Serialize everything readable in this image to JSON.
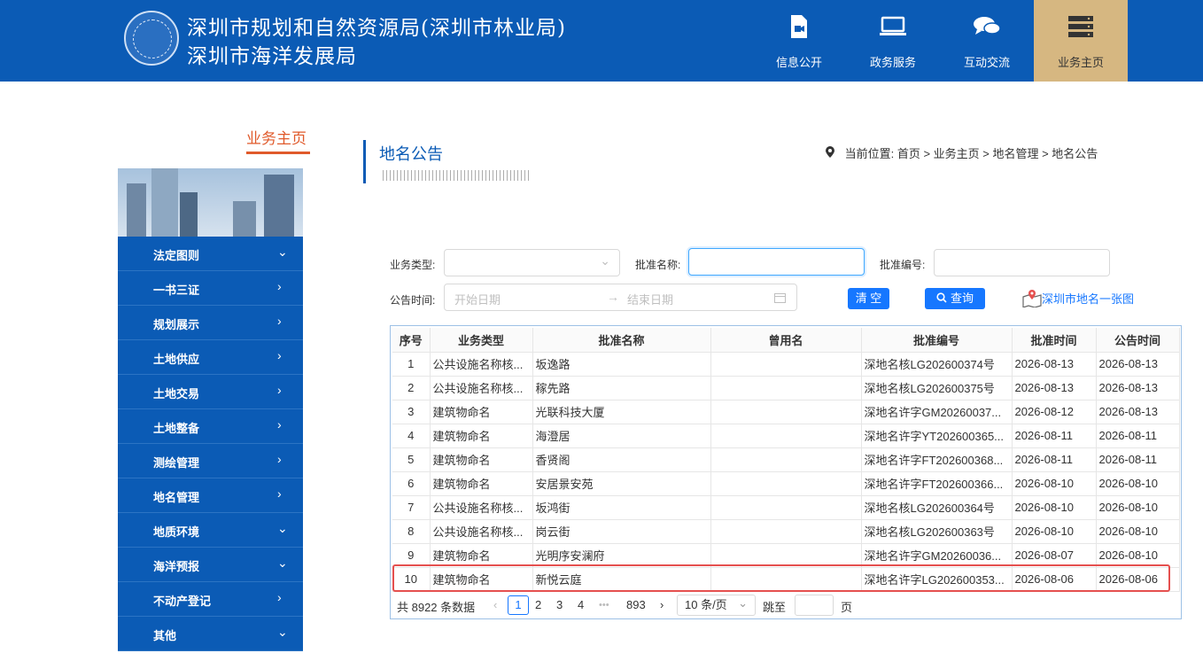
{
  "header": {
    "org_line1": "深圳市规划和自然资源局(深圳市林业局)",
    "org_line2": "深圳市海洋发展局",
    "nav": [
      {
        "label": "信息公开",
        "icon": "document-video-icon"
      },
      {
        "label": "政务服务",
        "icon": "monitor-icon"
      },
      {
        "label": "互动交流",
        "icon": "chat-bubbles-icon"
      },
      {
        "label": "业务主页",
        "icon": "server-icon",
        "active": true
      }
    ],
    "bg_color": "#0b5bb5",
    "active_color": "#d6b781"
  },
  "sidebar": {
    "title": "业务主页",
    "items": [
      {
        "label": "法定图则",
        "chev": "⌄"
      },
      {
        "label": "一书三证",
        "chev": "›"
      },
      {
        "label": "规划展示",
        "chev": "›"
      },
      {
        "label": "土地供应",
        "chev": "›"
      },
      {
        "label": "土地交易",
        "chev": "›"
      },
      {
        "label": "土地整备",
        "chev": "›"
      },
      {
        "label": "测绘管理",
        "chev": "›"
      },
      {
        "label": "地名管理",
        "chev": "›"
      },
      {
        "label": "地质环境",
        "chev": "⌄"
      },
      {
        "label": "海洋预报",
        "chev": "⌄"
      },
      {
        "label": "不动产登记",
        "chev": "›"
      },
      {
        "label": "其他",
        "chev": "⌄"
      }
    ]
  },
  "page": {
    "title": "地名公告",
    "breadcrumb": "当前位置:  首页 > 业务主页 > 地名管理 > 地名公告"
  },
  "filters": {
    "type_label": "业务类型:",
    "name_label": "批准名称:",
    "code_label": "批准编号:",
    "date_label": "公告时间:",
    "start_placeholder": "开始日期",
    "end_placeholder": "结束日期",
    "clear_label": "清 空",
    "query_label": "查询",
    "map_link": "深圳市地名一张图"
  },
  "table": {
    "columns": [
      "序号",
      "业务类型",
      "批准名称",
      "曾用名",
      "批准编号",
      "批准时间",
      "公告时间"
    ],
    "rows": [
      [
        "1",
        "公共设施名称核...",
        "坂逸路",
        "",
        "深地名核LG202600374号",
        "2026-08-13",
        "2026-08-13"
      ],
      [
        "2",
        "公共设施名称核...",
        "稼先路",
        "",
        "深地名核LG202600375号",
        "2026-08-13",
        "2026-08-13"
      ],
      [
        "3",
        "建筑物命名",
        "光联科技大厦",
        "",
        "深地名许字GM20260037...",
        "2026-08-12",
        "2026-08-13"
      ],
      [
        "4",
        "建筑物命名",
        "海澄居",
        "",
        "深地名许字YT202600365...",
        "2026-08-11",
        "2026-08-11"
      ],
      [
        "5",
        "建筑物命名",
        "香贤阁",
        "",
        "深地名许字FT202600368...",
        "2026-08-11",
        "2026-08-11"
      ],
      [
        "6",
        "建筑物命名",
        "安居景安苑",
        "",
        "深地名许字FT202600366...",
        "2026-08-10",
        "2026-08-10"
      ],
      [
        "7",
        "公共设施名称核...",
        "坂鸿街",
        "",
        "深地名核LG202600364号",
        "2026-08-10",
        "2026-08-10"
      ],
      [
        "8",
        "公共设施名称核...",
        "岗云街",
        "",
        "深地名核LG202600363号",
        "2026-08-10",
        "2026-08-10"
      ],
      [
        "9",
        "建筑物命名",
        "光明序安澜府",
        "",
        "深地名许字GM20260036...",
        "2026-08-07",
        "2026-08-10"
      ],
      [
        "10",
        "建筑物命名",
        "新悦云庭",
        "",
        "深地名许字LG202600353...",
        "2026-08-06",
        "2026-08-06"
      ]
    ],
    "highlighted_row": 10
  },
  "pagination": {
    "total": "共 8922 条数据",
    "prev": "‹",
    "current": "1",
    "pages": [
      "2",
      "3",
      "4"
    ],
    "ellipsis": "•••",
    "last": "893",
    "next": "›",
    "page_size": "10 条/页",
    "jump_label": "跳至",
    "page_suffix": "页"
  }
}
